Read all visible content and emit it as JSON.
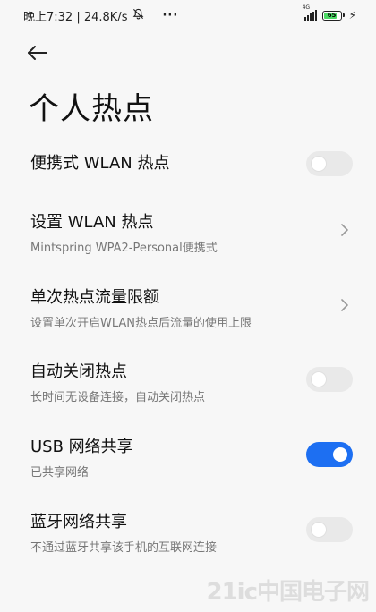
{
  "status_bar": {
    "time_text": "晚上7:32 | 24.8K/s",
    "mute_icon": "bell-off-icon",
    "more_text": "···",
    "network_label": "4G",
    "battery_level": "65"
  },
  "header": {
    "back_icon": "arrow-left-icon",
    "title": "个人热点"
  },
  "items": [
    {
      "title": "便携式 WLAN 热点",
      "subtitle": "",
      "control": "toggle",
      "on": false
    },
    {
      "title": "设置 WLAN 热点",
      "subtitle": "Mintspring WPA2-Personal便携式",
      "control": "chevron"
    },
    {
      "title": "单次热点流量限额",
      "subtitle": "设置单次开启WLAN热点后流量的使用上限",
      "control": "chevron"
    },
    {
      "title": "自动关闭热点",
      "subtitle": "长时间无设备连接，自动关闭热点",
      "control": "toggle",
      "on": false
    },
    {
      "title": "USB 网络共享",
      "subtitle": "已共享网络",
      "control": "toggle",
      "on": true
    },
    {
      "title": "蓝牙网络共享",
      "subtitle": "不通过蓝牙共享该手机的互联网连接",
      "control": "toggle",
      "on": false
    }
  ],
  "colors": {
    "toggle_on": "#1d6ff2",
    "toggle_off": "#e9e9e9",
    "background": "#f7f7f7"
  },
  "watermark": "21ic中国电子网"
}
